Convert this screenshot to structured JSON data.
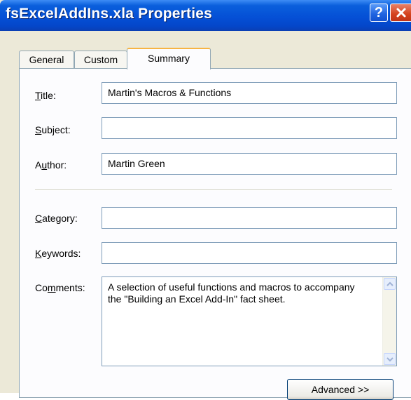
{
  "window": {
    "title": "fsExcelAddIns.xla Properties",
    "help_label": "?",
    "close_label": "X"
  },
  "tabs": [
    {
      "label": "General",
      "active": false
    },
    {
      "label": "Custom",
      "active": false
    },
    {
      "label": "Summary",
      "active": true
    }
  ],
  "fields": {
    "title": {
      "label_pre": "",
      "label_key": "T",
      "label_post": "itle:",
      "value": "Martin's Macros & Functions"
    },
    "subject": {
      "label_pre": "",
      "label_key": "S",
      "label_post": "ubject:",
      "value": ""
    },
    "author": {
      "label_pre": "A",
      "label_key": "u",
      "label_post": "thor:",
      "value": "Martin Green"
    },
    "category": {
      "label_pre": "",
      "label_key": "C",
      "label_post": "ategory:",
      "value": ""
    },
    "keywords": {
      "label_pre": "",
      "label_key": "K",
      "label_post": "eywords:",
      "value": ""
    },
    "comments": {
      "label_pre": "Co",
      "label_key": "m",
      "label_post": "ments:",
      "value": "A selection of useful functions and macros to accompany the \"Building an Excel Add-In\" fact sheet."
    }
  },
  "buttons": {
    "advanced": "Advanced >>"
  },
  "colors": {
    "titlebar": "#0550d6",
    "dialog_bg": "#ece9d8",
    "active_tab_accent": "#f7b443",
    "field_border": "#7f9db9"
  }
}
